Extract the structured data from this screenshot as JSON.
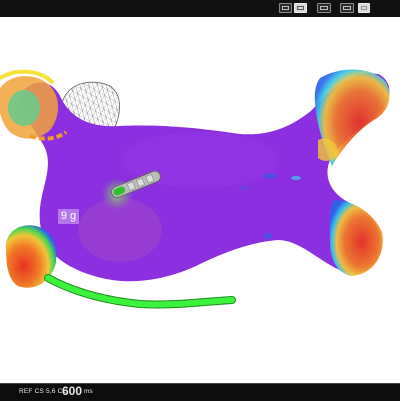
{
  "toolbar": {
    "buttons": [
      {
        "icon": "zoom-fit-icon",
        "active": false
      },
      {
        "icon": "map-view-icon",
        "active": true
      },
      {
        "icon": "dual-view-icon",
        "active": false
      },
      {
        "icon": "quad-view-icon",
        "active": false
      },
      {
        "icon": "toggle-icon",
        "active": true
      }
    ]
  },
  "viewport": {
    "force_value": "9 g",
    "map_colors": [
      "#8b2fe0",
      "#2b63e8",
      "#38c8e8",
      "#4fd84f",
      "#f2e337",
      "#f29b2a",
      "#e83222"
    ]
  },
  "status": {
    "ref_text": "REF CS 5,6 CL",
    "cycle_length": "600",
    "unit": "ms"
  }
}
